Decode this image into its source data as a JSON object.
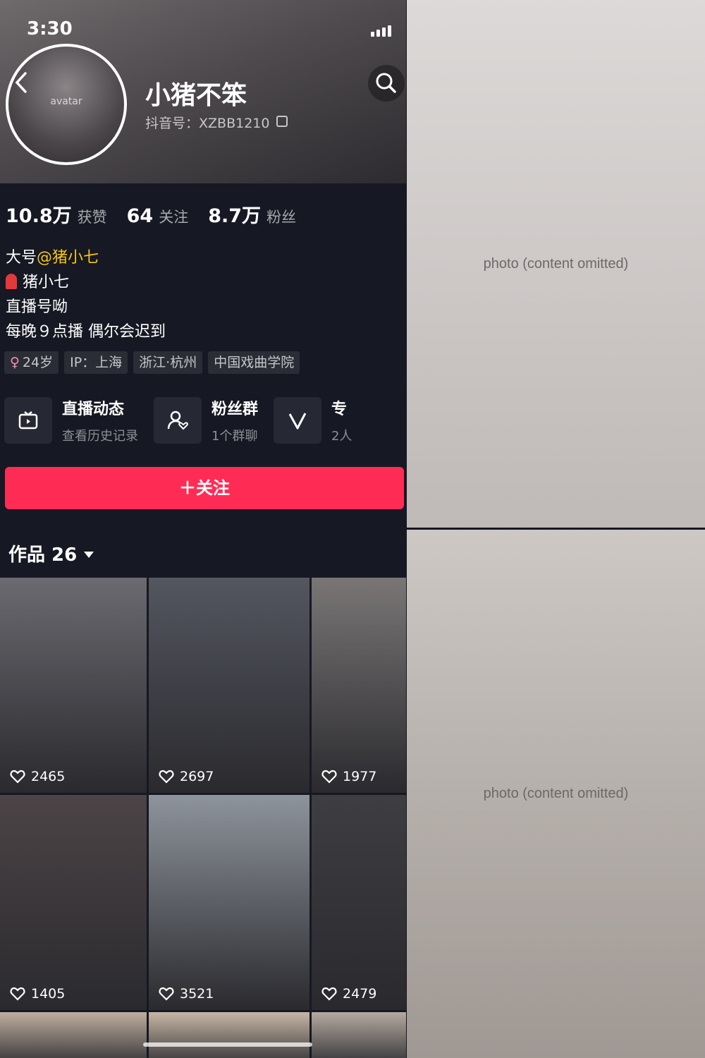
{
  "status_bar": {
    "time": "3:30"
  },
  "profile": {
    "name": "小猪不笨",
    "douyin_id": "抖音号：XZBB1210",
    "avatar_label": "avatar"
  },
  "stats": [
    {
      "value": "10.8万",
      "label": "获赞"
    },
    {
      "value": "64",
      "label": "关注"
    },
    {
      "value": "8.7万",
      "label": "粉丝"
    }
  ],
  "bio": {
    "line1_prefix": "大号",
    "line1_mention": "@猪小七",
    "line2": "猪小七",
    "line3": "直播号呦",
    "line4": "每晚９点播 偶尔会迟到"
  },
  "tags": [
    {
      "icon": "female-icon",
      "text": "24岁"
    },
    {
      "text": "IP：上海"
    },
    {
      "text": "浙江·杭州"
    },
    {
      "text": "中国戏曲学院"
    }
  ],
  "features": [
    {
      "icon": "live-tv-icon",
      "title": "直播动态",
      "subtitle": "查看历史记录"
    },
    {
      "icon": "fan-group-icon",
      "title": "粉丝群",
      "subtitle": "1个群聊"
    },
    {
      "icon": "collection-v-icon",
      "title": "专",
      "subtitle": "2人"
    }
  ],
  "follow_button": "＋关注",
  "works_tab": "作品 26",
  "videos": [
    {
      "likes": "2465",
      "bg": "#6b6a70"
    },
    {
      "likes": "2697",
      "bg": "#545660"
    },
    {
      "likes": "1977",
      "bg": "#7a7676"
    },
    {
      "likes": "1405",
      "bg": "#4c4446"
    },
    {
      "likes": "3521",
      "bg": "#8e949c"
    },
    {
      "likes": "2479",
      "bg": "#3e3e42"
    },
    {
      "likes": "",
      "bg": "#bfae9f"
    },
    {
      "likes": "",
      "bg": "#c7b6a5"
    },
    {
      "likes": "",
      "bg": "#b4aaa1"
    }
  ],
  "photos": {
    "top_label": "photo (content omitted)",
    "bottom_label": "photo (content omitted)"
  },
  "colors": {
    "background": "#161823",
    "follow_button": "#fe2c55",
    "mention": "#f5c518"
  }
}
